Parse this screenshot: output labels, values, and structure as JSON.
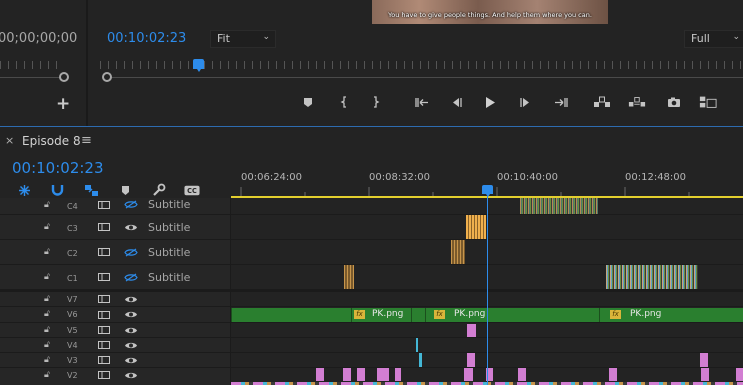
{
  "source_monitor": {
    "timecode": "00;00;00;00"
  },
  "program_monitor": {
    "timecode": "00:10:02:23",
    "subtitle_preview": "You have to give people things. And help them where you can.",
    "fit_dropdown": "Fit",
    "quality_dropdown": "Full"
  },
  "transport_controls": [
    "add-marker",
    "mark-in",
    "mark-out",
    "go-to-in",
    "step-back",
    "play",
    "step-forward",
    "go-to-out",
    "lift",
    "extract",
    "export-frame",
    "button-editor"
  ],
  "sequence": {
    "close_glyph": "×",
    "tab_name": "Episode 8",
    "menu_glyph": "≡",
    "timecode": "00:10:02:23",
    "ruler_labels": [
      "00:06:24:00",
      "00:08:32:00",
      "00:10:40:00",
      "00:12:48:00"
    ]
  },
  "tracks": [
    {
      "id": "C4",
      "label": "Subtitle",
      "eye": "hidden"
    },
    {
      "id": "C3",
      "label": "Subtitle",
      "eye": "visible"
    },
    {
      "id": "C2",
      "label": "Subtitle",
      "eye": "hidden"
    },
    {
      "id": "C1",
      "label": "Subtitle",
      "eye": "hidden"
    },
    {
      "id": "V7",
      "label": "",
      "eye": "visible"
    },
    {
      "id": "V6",
      "label": "",
      "eye": "visible"
    },
    {
      "id": "V5",
      "label": "",
      "eye": "visible"
    },
    {
      "id": "V4",
      "label": "",
      "eye": "visible"
    },
    {
      "id": "V3",
      "label": "",
      "eye": "visible"
    },
    {
      "id": "V2",
      "label": "",
      "eye": "visible"
    }
  ],
  "clips": {
    "png_name": "PK.png",
    "fx_badge": "fx"
  },
  "colors": {
    "accent_blue": "#2d8ceb",
    "work_area_yellow": "#e3cf2e",
    "clip_green": "#2a7f2f",
    "clip_pink": "#d27ed2",
    "clip_cyan": "#44b7d6",
    "clip_orange": "#e7a74a"
  }
}
